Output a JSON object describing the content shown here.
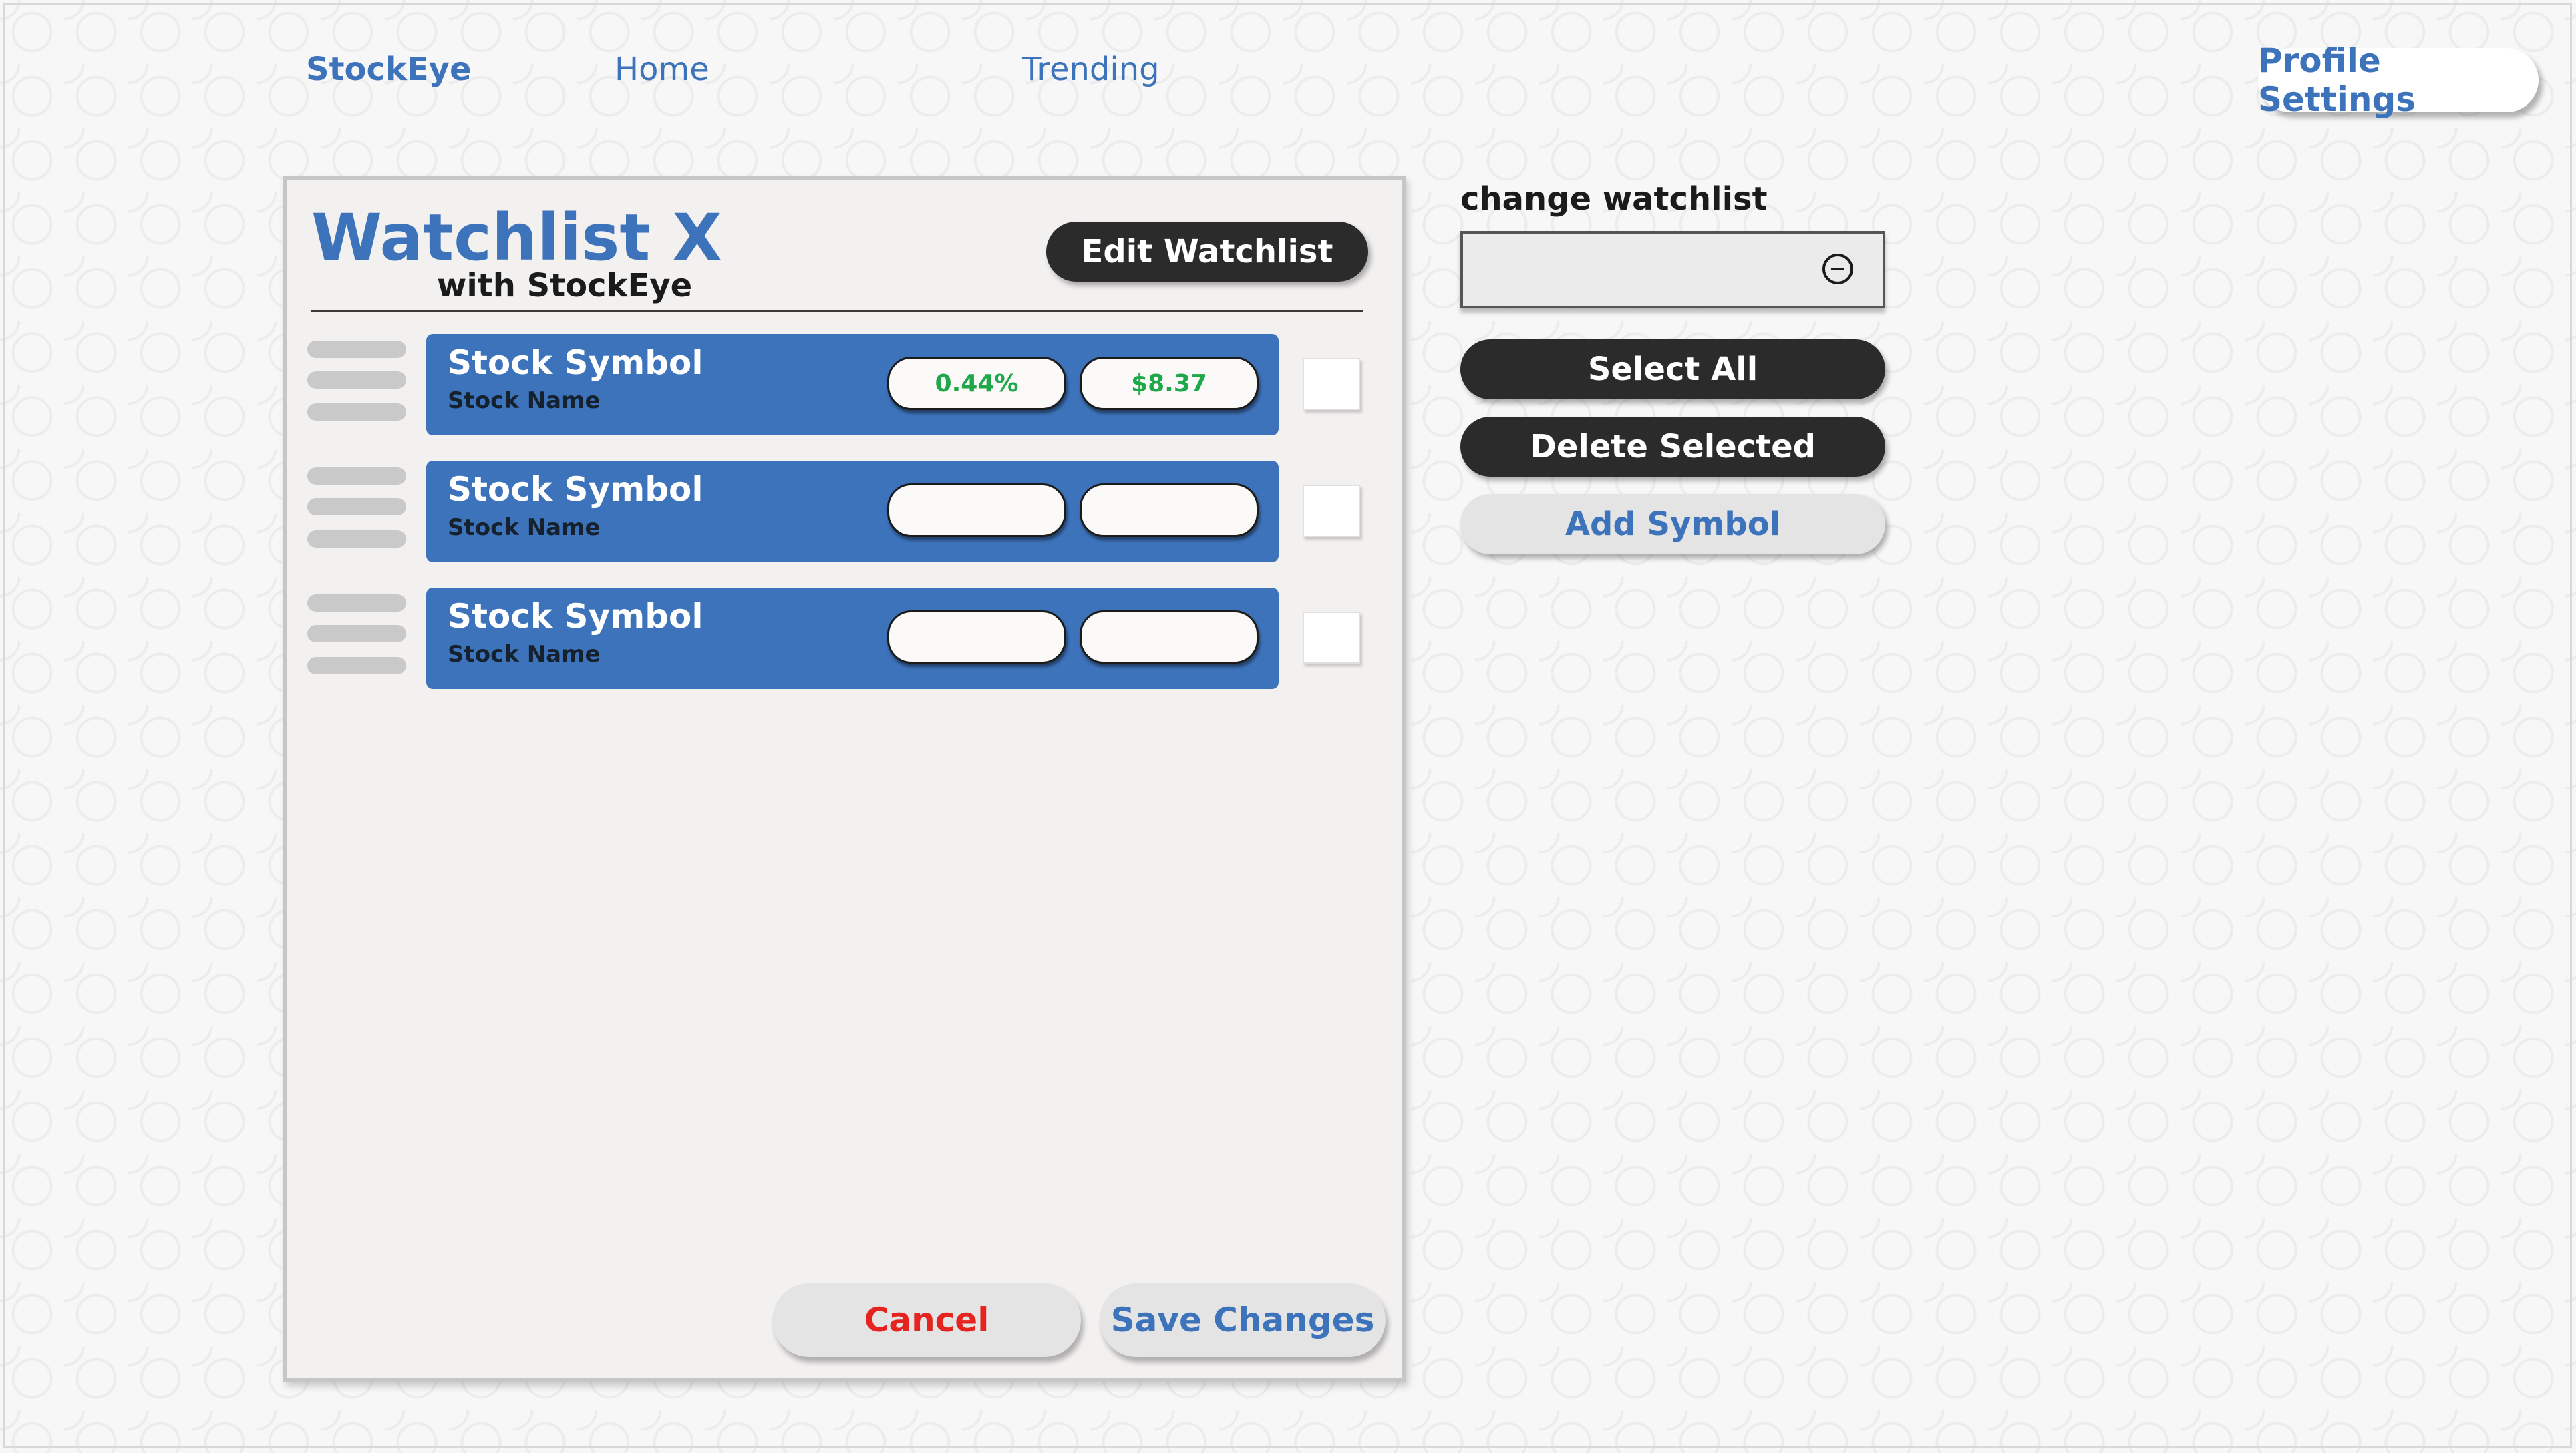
{
  "nav": {
    "brand": "StockEye",
    "home": "Home",
    "trending": "Trending",
    "profile_settings": "Profile Settings"
  },
  "watchlist": {
    "title": "Watchlist X",
    "subtitle": "with StockEye",
    "edit_label": "Edit Watchlist",
    "rows": [
      {
        "symbol": "Stock Symbol",
        "name": "Stock Name",
        "change": "0.44%",
        "price": "$8.37",
        "checked": false
      },
      {
        "symbol": "Stock Symbol",
        "name": "Stock Name",
        "change": "",
        "price": "",
        "checked": false
      },
      {
        "symbol": "Stock Symbol",
        "name": "Stock Name",
        "change": "",
        "price": "",
        "checked": false
      }
    ],
    "cancel_label": "Cancel",
    "save_label": "Save Changes"
  },
  "side_panel": {
    "change_label": "change watchlist",
    "select_value": "",
    "select_icon": "minus-circle-icon",
    "select_all_label": "Select All",
    "delete_label": "Delete Selected",
    "add_label": "Add Symbol"
  },
  "colors": {
    "accent": "#3d73bb",
    "dark_button": "#2b2b2b",
    "gain": "#1ea84a",
    "cancel": "#e5231f",
    "card_bg": "#f3f1f0"
  }
}
